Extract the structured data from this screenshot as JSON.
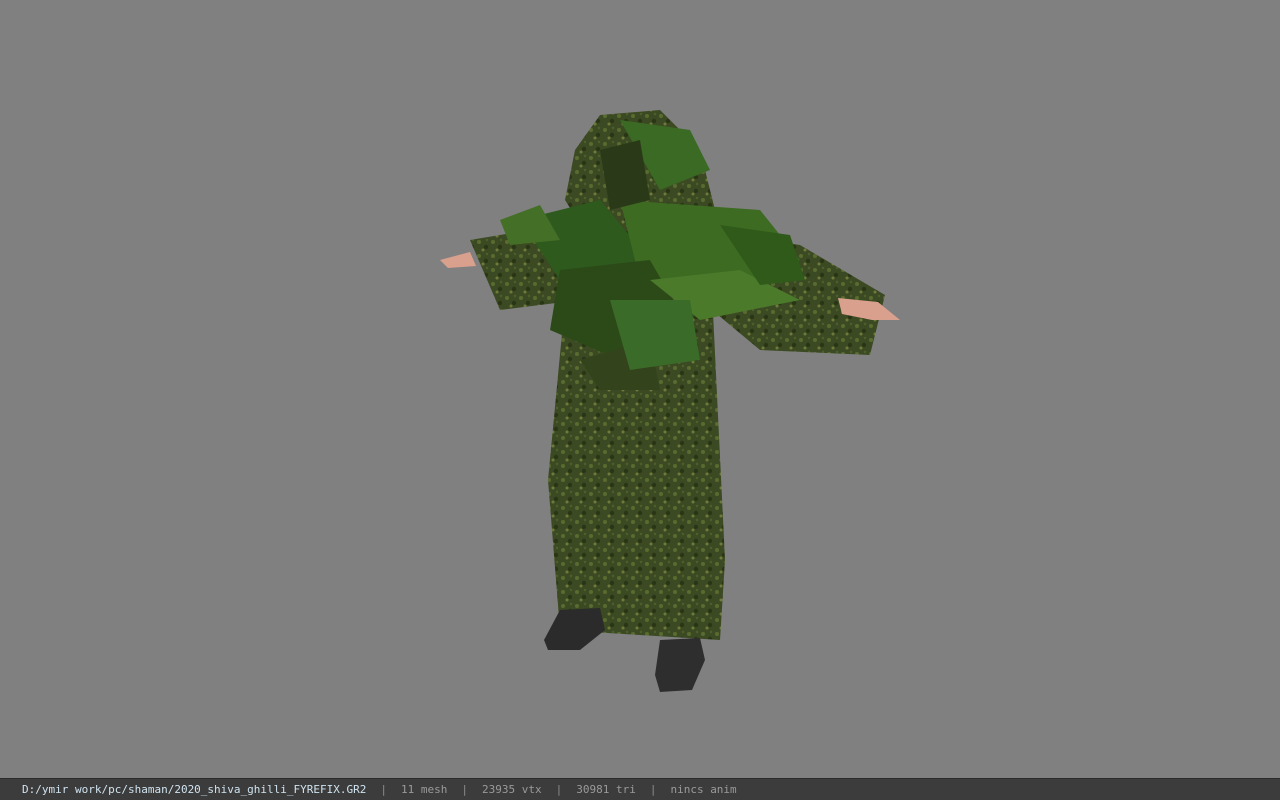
{
  "viewer": {
    "background_color": "#808080",
    "model_name": "ghillie-suit-character"
  },
  "status": {
    "file_path": "D:/ymir work/pc/shaman/2020_shiva_ghilli_FYREFIX.GR2",
    "separator": "|",
    "mesh": "11 mesh",
    "vtx": "23935 vtx",
    "tri": "30981 tri",
    "anim": "nincs anim"
  }
}
